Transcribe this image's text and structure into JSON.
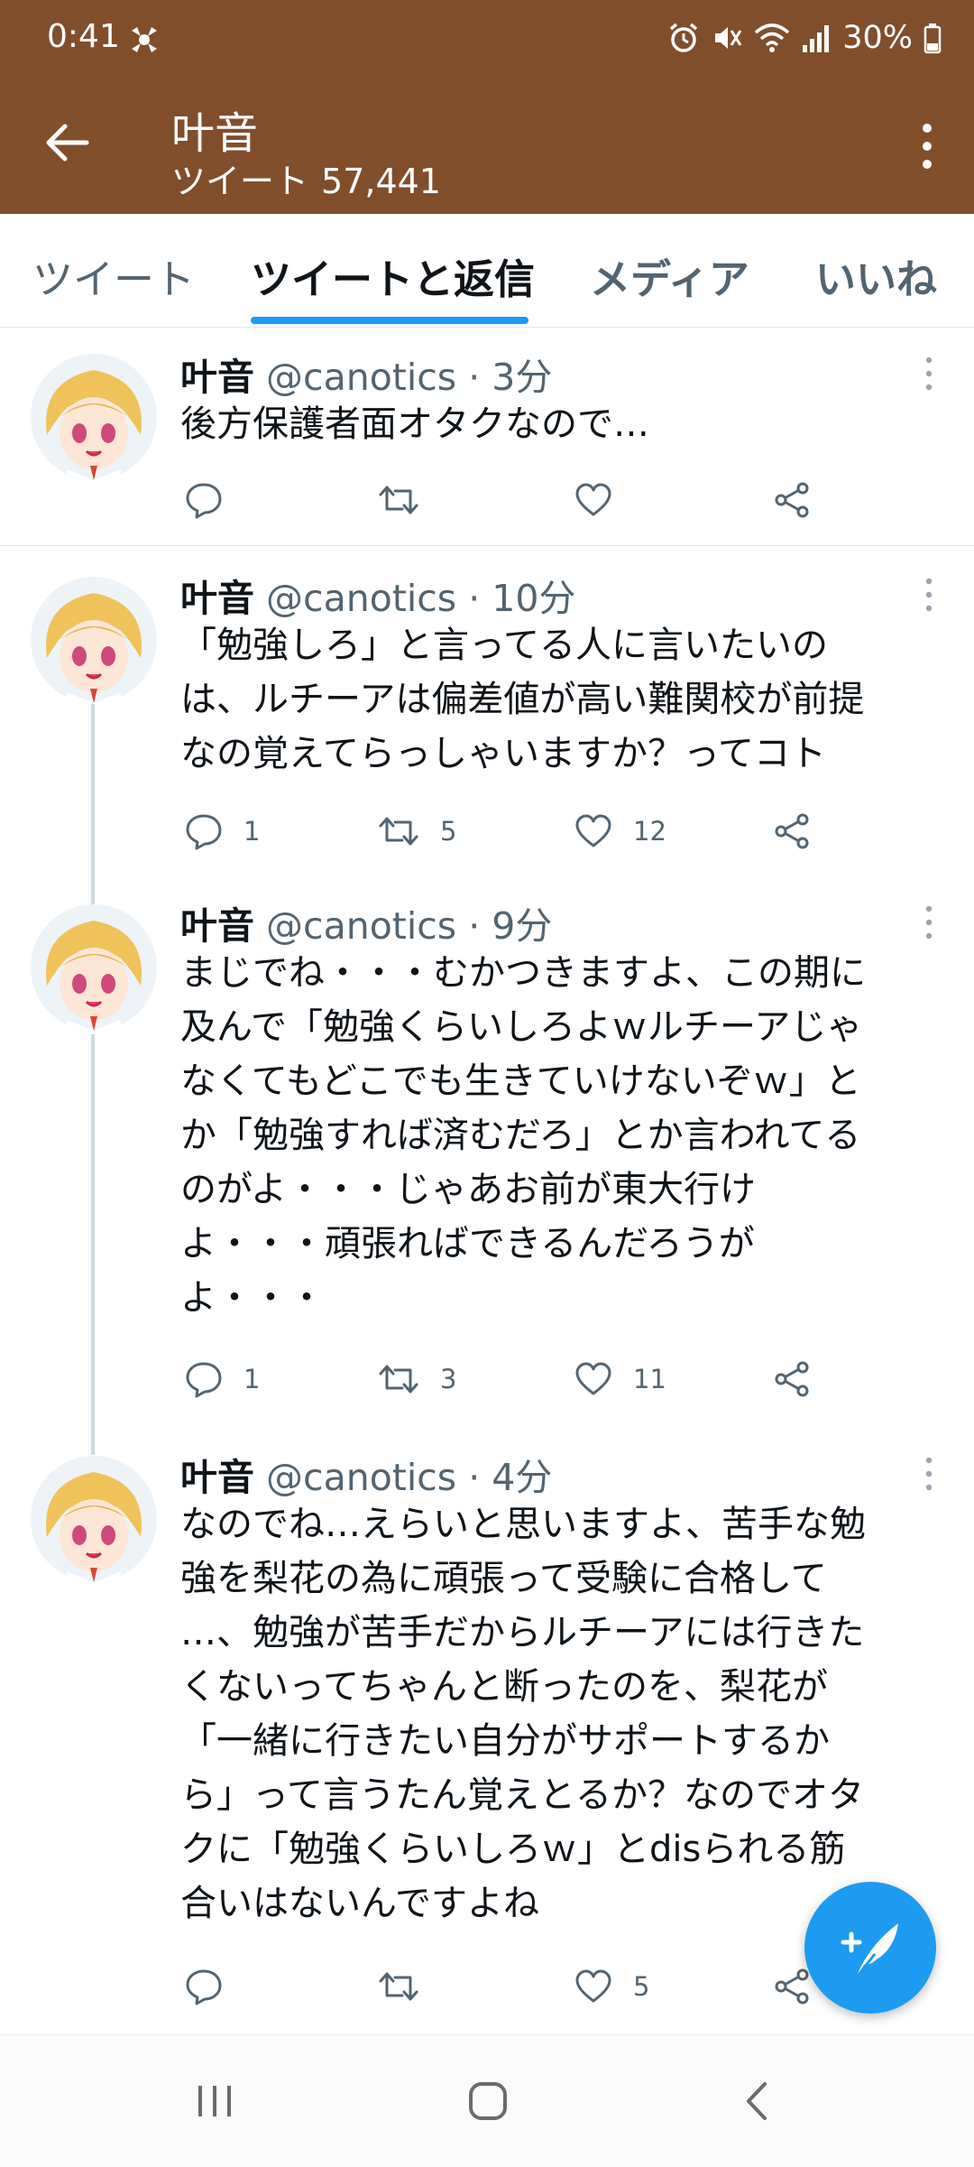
{
  "status_bar": {
    "time": "0:41",
    "battery": "30%"
  },
  "header": {
    "name": "叶音",
    "tweet_count_label": "ツイート",
    "tweet_count": "57,441"
  },
  "tabs": [
    {
      "label": "ツイート"
    },
    {
      "label": "ツイートと返信",
      "active": true
    },
    {
      "label": "メディア"
    },
    {
      "label": "いいね"
    }
  ],
  "tweets": [
    {
      "name": "叶音",
      "handle": "@canotics",
      "time": "3分",
      "text": "後方保護者面オタクなので…",
      "replies": "",
      "retweets": "",
      "likes": ""
    },
    {
      "name": "叶音",
      "handle": "@canotics",
      "time": "10分",
      "text": "「勉強しろ」と言ってる人に言いたいの\nは、ルチーアは偏差値が高い難関校が前提\nなの覚えてらっしゃいますか？ってコト",
      "replies": "1",
      "retweets": "5",
      "likes": "12"
    },
    {
      "name": "叶音",
      "handle": "@canotics",
      "time": "9分",
      "text": "まじでね・・・むかつきますよ、この期に\n及んで「勉強くらいしろよｗルチーアじゃ\nなくてもどこでも生きていけないぞｗ」と\nか「勉強すれば済むだろ」とか言われてる\nのがよ・・・じゃあお前が東大行け\nよ・・・頑張ればできるんだろうが\nよ・・・",
      "replies": "1",
      "retweets": "3",
      "likes": "11"
    },
    {
      "name": "叶音",
      "handle": "@canotics",
      "time": "4分",
      "text": "なのでね…えらいと思いますよ、苦手な勉\n強を梨花の為に頑張って受験に合格して\n…、勉強が苦手だからルチーアには行きた\nくないってちゃんと断ったのを、梨花が\n「一緒に行きたい自分がサポートするか\nら」って言うたん覚えとるか？なのでオタ\nクに「勉強くらいしろｗ」とdisられる筋\n合いはないんですよね",
      "replies": "",
      "retweets": "",
      "likes": "5"
    }
  ],
  "colors": {
    "header_bg": "#814e2c",
    "accent": "#1d9bf0",
    "secondary_text": "#536471"
  }
}
